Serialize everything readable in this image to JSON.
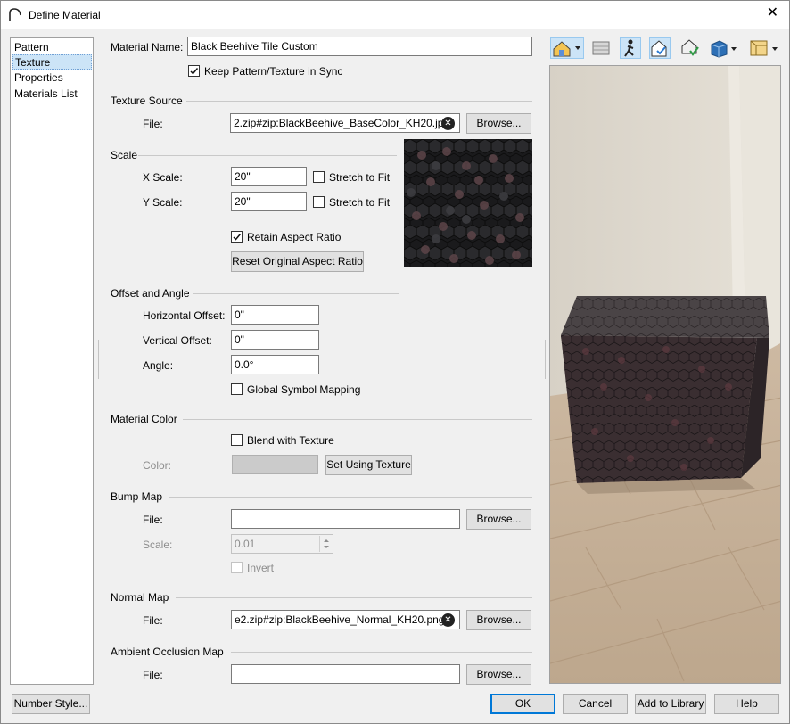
{
  "window": {
    "title": "Define Material",
    "close_label": "✕"
  },
  "nav": {
    "items": [
      {
        "label": "Pattern",
        "selected": false
      },
      {
        "label": "Texture",
        "selected": true
      },
      {
        "label": "Properties",
        "selected": false
      },
      {
        "label": "Materials List",
        "selected": false
      }
    ]
  },
  "material": {
    "name_label": "Material Name:",
    "name_value": "Black Beehive Tile Custom",
    "sync_label": "Keep Pattern/Texture in Sync",
    "sync_checked": true
  },
  "texture_source": {
    "section_label": "Texture Source",
    "file_label": "File:",
    "file_value": "2.zip#zip:BlackBeehive_BaseColor_KH20.jpg",
    "browse_label": "Browse..."
  },
  "scale": {
    "section_label": "Scale",
    "x_label": "X Scale:",
    "x_value": "20\"",
    "y_label": "Y Scale:",
    "y_value": "20\"",
    "stretch_x_label": "Stretch to Fit",
    "stretch_y_label": "Stretch to Fit",
    "retain_label": "Retain Aspect Ratio",
    "retain_checked": true,
    "reset_label": "Reset Original Aspect Ratio"
  },
  "offset": {
    "section_label": "Offset and Angle",
    "h_label": "Horizontal Offset:",
    "h_value": "0\"",
    "v_label": "Vertical Offset:",
    "v_value": "0\"",
    "angle_label": "Angle:",
    "angle_value": "0.0°",
    "global_label": "Global Symbol Mapping"
  },
  "material_color": {
    "section_label": "Material Color",
    "blend_label": "Blend with Texture",
    "color_label": "Color:",
    "swatch_color": "#cbcbcb",
    "set_label": "Set Using Texture"
  },
  "bump_map": {
    "section_label": "Bump Map",
    "file_label": "File:",
    "file_value": "",
    "browse_label": "Browse...",
    "scale_label": "Scale:",
    "scale_value": "0.01",
    "invert_label": "Invert"
  },
  "normal_map": {
    "section_label": "Normal Map",
    "file_label": "File:",
    "file_value": "e2.zip#zip:BlackBeehive_Normal_KH20.png",
    "browse_label": "Browse..."
  },
  "ao_map": {
    "section_label": "Ambient Occlusion Map",
    "file_label": "File:",
    "file_value": "",
    "browse_label": "Browse..."
  },
  "footer": {
    "number_style_label": "Number Style...",
    "ok_label": "OK",
    "cancel_label": "Cancel",
    "add_library_label": "Add to Library",
    "help_label": "Help"
  },
  "toolbar": {
    "icons": [
      "house-render-icon",
      "layers-icon",
      "walk-camera-icon",
      "house-check-icon",
      "house-shield-icon",
      "cube-icon",
      "room-box-icon"
    ]
  },
  "colors": {
    "accent": "#0078d7",
    "selection": "#cce4f7"
  }
}
